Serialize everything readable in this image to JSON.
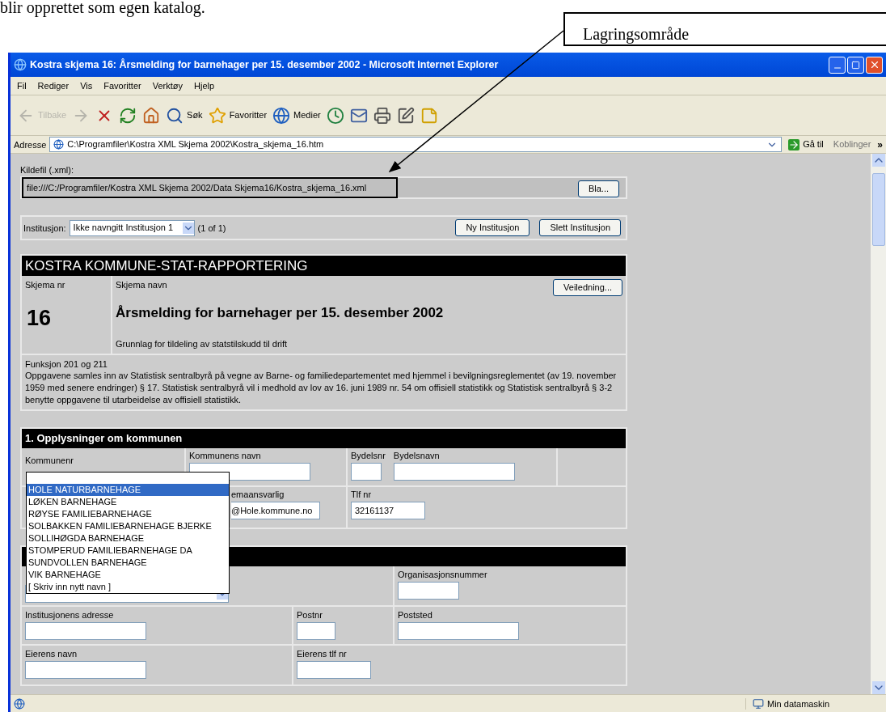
{
  "document": {
    "text": "blir opprettet som egen katalog.",
    "callout": "Lagringsområde"
  },
  "window": {
    "title": "Kostra skjema 16: Årsmelding for barnehager per 15. desember 2002 - Microsoft Internet Explorer"
  },
  "menu": [
    "Fil",
    "Rediger",
    "Vis",
    "Favoritter",
    "Verktøy",
    "Hjelp"
  ],
  "toolbar": [
    {
      "kind": "back",
      "label": "Tilbake",
      "disabled": true
    },
    {
      "kind": "forward",
      "disabled": true
    },
    {
      "kind": "stop",
      "disabled": false
    },
    {
      "kind": "refresh",
      "disabled": false
    },
    {
      "kind": "home",
      "disabled": false
    },
    {
      "kind": "search",
      "label": "Søk",
      "disabled": false
    },
    {
      "kind": "favorites",
      "label": "Favoritter",
      "disabled": false
    },
    {
      "kind": "media",
      "label": "Medier",
      "disabled": false
    },
    {
      "kind": "history",
      "disabled": false
    },
    {
      "kind": "mail",
      "disabled": false
    },
    {
      "kind": "print",
      "disabled": false
    },
    {
      "kind": "edit",
      "disabled": false
    },
    {
      "kind": "note",
      "disabled": false
    }
  ],
  "address": {
    "label": "Adresse",
    "value": "C:\\Programfiler\\Kostra XML Skjema 2002\\Kostra_skjema_16.htm",
    "go": "Gå til",
    "links": "Koblinger",
    "more": "»"
  },
  "source": {
    "label": "Kildefil (.xml):",
    "value": "file:///C:/Programfiler/Kostra XML Skjema 2002/Data Skjema16/Kostra_skjema_16.xml",
    "button": "Bla..."
  },
  "institution": {
    "label": "Institusjon:",
    "value": "Ikke navngitt Institusjon 1",
    "count": "(1 of 1)",
    "buttons": [
      "Ny Institusjon",
      "Slett Institusjon"
    ]
  },
  "header": {
    "title": "KOSTRA KOMMUNE-STAT-RAPPORTERING",
    "number_label": "Skjema nr",
    "number": "16",
    "name_label": "Skjema navn",
    "guide_button": "Veiledning...",
    "name": "Årsmelding for barnehager per 15. desember 2002",
    "subtitle": "Grunnlag for tildeling av statstilskudd til drift",
    "function": "Funksjon 201 og 211",
    "description": "Oppgavene samles inn av Statistisk sentralbyrå på vegne av Barne- og familiedepartementet med hjemmel i bevilgningsreglementet (av 19. november 1959 med senere endringer) § 17. Statistisk sentralbyrå vil i medhold av lov av 16. juni 1989 nr. 54 om offisiell statistikk og Statistisk sentralbyrå § 3-2 benytte oppgavene til utarbeidelse av offisiell statistikk."
  },
  "section1": {
    "title": "1. Opplysninger om kommunen",
    "kommunenr": "Kommunenr",
    "kommunens_navn": "Kommunens navn",
    "bydelsnr": "Bydelsnr",
    "bydelsnavn": "Bydelsnavn",
    "contact_label": "emaansvarlig",
    "contact_value": "@Hole.kommune.no",
    "phone_label": "Tlf nr",
    "phone_value": "32161137"
  },
  "dropdown": [
    {
      "label": "HOLE NATURBARNEHAGE",
      "selected": true
    },
    {
      "label": "LØKEN BARNEHAGE",
      "selected": false
    },
    {
      "label": "RØYSE FAMILIEBARNEHAGE",
      "selected": false
    },
    {
      "label": "SOLBAKKEN FAMILIEBARNEHAGE BJERKE",
      "selected": false
    },
    {
      "label": "SOLLIHØGDA BARNEHAGE",
      "selected": false
    },
    {
      "label": "STOMPERUD FAMILIEBARNEHAGE DA",
      "selected": false
    },
    {
      "label": "SUNDVOLLEN BARNEHAGE",
      "selected": false
    },
    {
      "label": "VIK BARNEHAGE",
      "selected": false
    },
    {
      "label": "[ Skriv inn nytt navn ]",
      "selected": false
    }
  ],
  "section2": {
    "org_label": "Organisasjonsnummer",
    "address_label": "Institusjonens adresse",
    "postnr_label": "Postnr",
    "poststed_label": "Poststed",
    "owner_label": "Eierens navn",
    "owner_phone_label": "Eierens tlf nr"
  },
  "status_bar": {
    "zone": "Min datamaskin"
  }
}
